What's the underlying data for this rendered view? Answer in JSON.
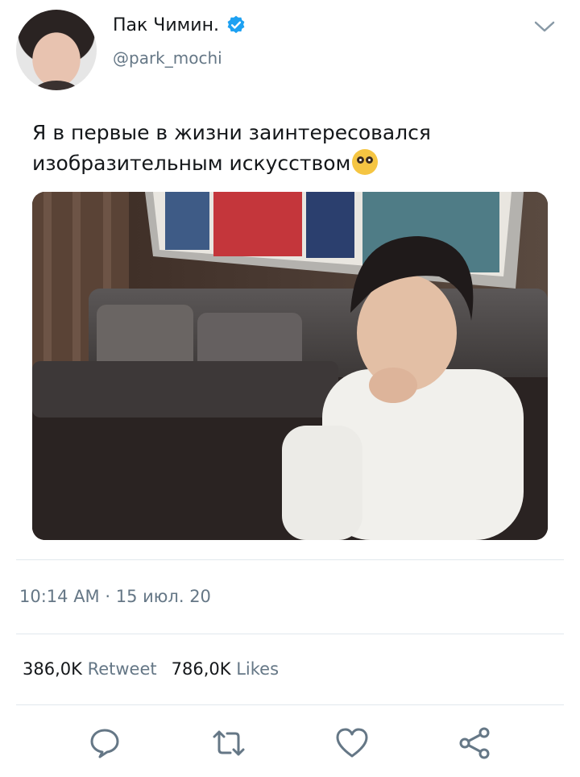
{
  "user": {
    "display_name": "Пак Чимин.",
    "handle": "@park_mochi",
    "verified": true,
    "avatar_icon": "profile-avatar"
  },
  "tweet": {
    "text_line1": "Я в первые в жизни заинтересовался",
    "text_line2": "изобразительным искусством",
    "emoji": "pleading-face-emoji",
    "timestamp": "10:14 AM · 15 июл. 20"
  },
  "stats": {
    "retweets_count": "386,0K",
    "retweets_label": "Retweet",
    "likes_count": "786,0K",
    "likes_label": "Likes"
  },
  "actions": {
    "reply_icon": "reply-icon",
    "retweet_icon": "retweet-icon",
    "like_icon": "heart-icon",
    "share_icon": "share-icon"
  },
  "colors": {
    "accent": "#1da1f2",
    "text": "#14171a",
    "secondary": "#657786",
    "divider": "#e1e8ed"
  }
}
